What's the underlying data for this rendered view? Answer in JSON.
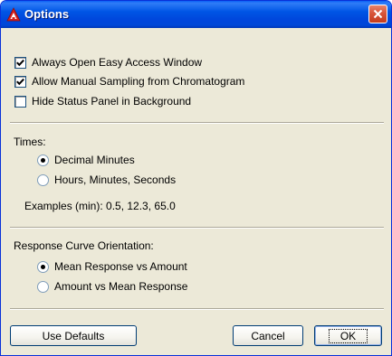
{
  "window": {
    "title": "Options"
  },
  "options": [
    {
      "label": "Always Open Easy Access Window",
      "checked": true
    },
    {
      "label": "Allow Manual Sampling from Chromatogram",
      "checked": true
    },
    {
      "label": "Hide Status Panel in Background",
      "checked": false
    }
  ],
  "times": {
    "heading": "Times:",
    "choices": [
      {
        "label": "Decimal Minutes",
        "selected": true
      },
      {
        "label": "Hours, Minutes, Seconds",
        "selected": false
      }
    ],
    "examples": "Examples (min): 0.5, 12.3, 65.0"
  },
  "response_curve": {
    "heading": "Response Curve Orientation:",
    "choices": [
      {
        "label": "Mean Response vs Amount",
        "selected": true
      },
      {
        "label": "Amount vs Mean Response",
        "selected": false
      }
    ]
  },
  "buttons": {
    "use_defaults": "Use Defaults",
    "cancel": "Cancel",
    "ok": "OK"
  },
  "colors": {
    "titlebar": "#0055e5",
    "dialog_bg": "#ece9d8",
    "close_button": "#d8553a"
  }
}
